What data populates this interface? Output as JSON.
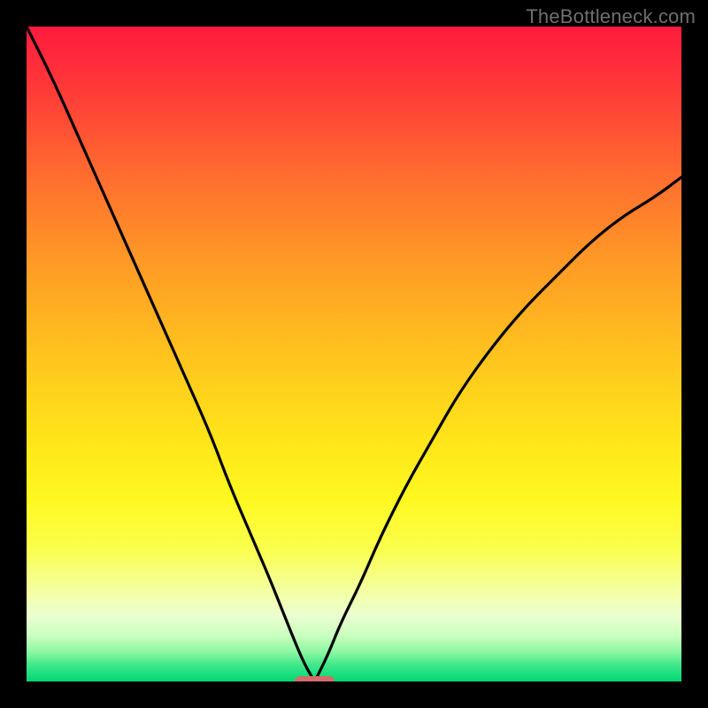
{
  "watermark": "TheBottleneck.com",
  "chart_data": {
    "type": "line",
    "title": "",
    "xlabel": "",
    "ylabel": "",
    "x_range": [
      0,
      100
    ],
    "y_range": [
      0,
      100
    ],
    "optimal_x": 44,
    "marker": {
      "x": 44,
      "width_pct": 6,
      "color": "#d66b6b"
    },
    "series": [
      {
        "name": "left-curve",
        "x": [
          0,
          4,
          8,
          12,
          16,
          20,
          24,
          28,
          31,
          34,
          37,
          39,
          41,
          42.5,
          44
        ],
        "y": [
          100,
          92,
          83,
          74,
          65,
          56,
          47,
          38,
          30,
          23,
          16,
          11,
          6,
          2.5,
          0
        ]
      },
      {
        "name": "right-curve",
        "x": [
          44,
          46,
          48,
          51,
          54,
          58,
          62,
          66,
          71,
          76,
          81,
          86,
          91,
          96,
          100
        ],
        "y": [
          0,
          4,
          9,
          15,
          22,
          30,
          37,
          44,
          51,
          57,
          62,
          67,
          71,
          74,
          77
        ]
      }
    ],
    "background_gradient": [
      {
        "offset": 0.0,
        "color": "#ff1a3f"
      },
      {
        "offset": 0.1,
        "color": "#ff3b38"
      },
      {
        "offset": 0.22,
        "color": "#ff6a2f"
      },
      {
        "offset": 0.36,
        "color": "#ff9a26"
      },
      {
        "offset": 0.5,
        "color": "#ffc31e"
      },
      {
        "offset": 0.62,
        "color": "#ffe21a"
      },
      {
        "offset": 0.72,
        "color": "#fff81f"
      },
      {
        "offset": 0.8,
        "color": "#faff4f"
      },
      {
        "offset": 0.86,
        "color": "#f4ffa0"
      },
      {
        "offset": 0.9,
        "color": "#eaffd0"
      },
      {
        "offset": 0.93,
        "color": "#c9ffc0"
      },
      {
        "offset": 0.955,
        "color": "#8cf7a2"
      },
      {
        "offset": 0.975,
        "color": "#3fe88a"
      },
      {
        "offset": 1.0,
        "color": "#00d774"
      }
    ]
  }
}
